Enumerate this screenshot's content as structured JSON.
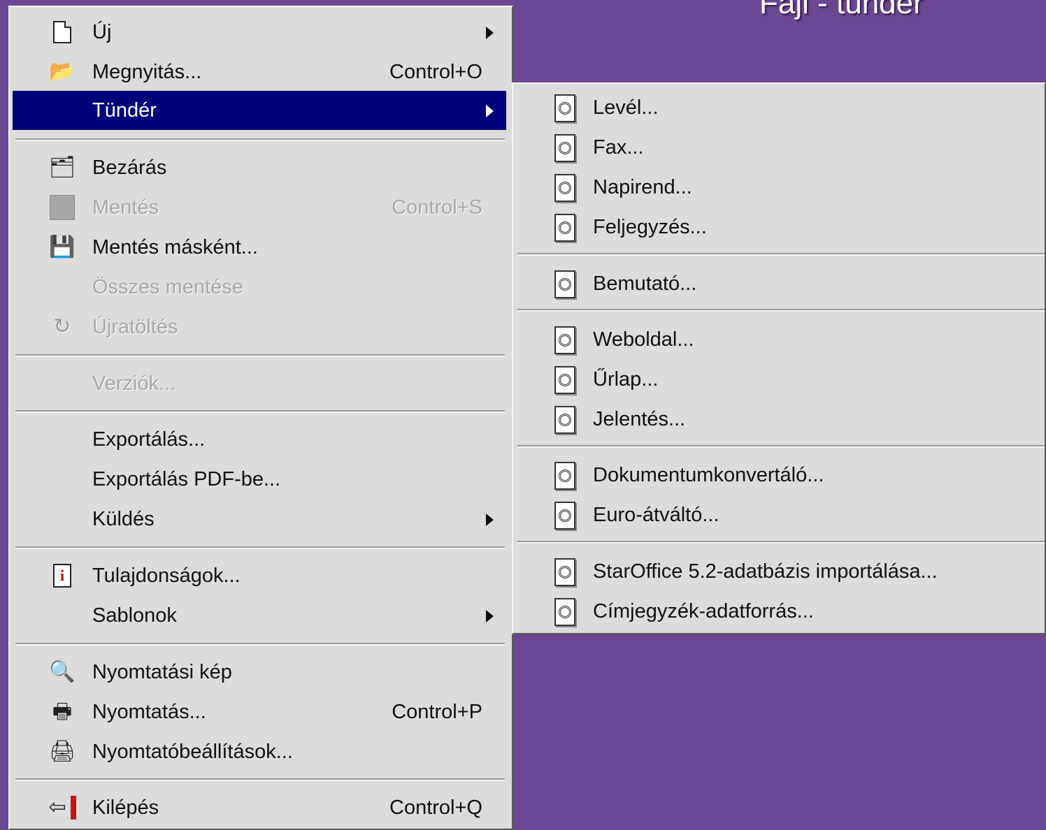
{
  "slide_title": "Fájl - tündér",
  "file_menu": {
    "items": [
      {
        "label": "Új",
        "icon": "new-document-icon",
        "submenu": true
      },
      {
        "label": "Megnyitás...",
        "icon": "open-folder-icon",
        "shortcut": "Control+O"
      },
      {
        "label": "Tündér",
        "submenu": true,
        "active": true
      },
      {
        "label": "Bezárás",
        "icon": "close-document-icon"
      },
      {
        "label": "Mentés",
        "icon": "save-icon",
        "shortcut": "Control+S",
        "disabled": true
      },
      {
        "label": "Mentés másként...",
        "icon": "save-as-icon"
      },
      {
        "label": "Összes mentése",
        "disabled": true
      },
      {
        "label": "Újratöltés",
        "icon": "reload-icon",
        "disabled": true
      },
      {
        "label": "Verziók...",
        "disabled": true
      },
      {
        "label": "Exportálás..."
      },
      {
        "label": "Exportálás PDF-be..."
      },
      {
        "label": "Küldés",
        "submenu": true
      },
      {
        "label": "Tulajdonságok...",
        "icon": "properties-icon"
      },
      {
        "label": "Sablonok",
        "submenu": true
      },
      {
        "label": "Nyomtatási kép",
        "icon": "print-preview-icon"
      },
      {
        "label": "Nyomtatás...",
        "icon": "printer-icon",
        "shortcut": "Control+P"
      },
      {
        "label": "Nyomtatóbeállítások...",
        "icon": "printer-settings-icon"
      },
      {
        "label": "Kilépés",
        "icon": "exit-icon",
        "shortcut": "Control+Q"
      }
    ]
  },
  "wizard_menu": {
    "items": [
      {
        "label": "Levél...",
        "icon": "wizard-icon"
      },
      {
        "label": "Fax...",
        "icon": "wizard-icon"
      },
      {
        "label": "Napirend...",
        "icon": "wizard-icon"
      },
      {
        "label": "Feljegyzés...",
        "icon": "wizard-icon"
      },
      {
        "label": "Bemutató...",
        "icon": "wizard-icon"
      },
      {
        "label": "Weboldal...",
        "icon": "wizard-icon"
      },
      {
        "label": "Űrlap...",
        "icon": "wizard-icon"
      },
      {
        "label": "Jelentés...",
        "icon": "wizard-icon"
      },
      {
        "label": "Dokumentumkonvertáló...",
        "icon": "wizard-icon"
      },
      {
        "label": "Euro-átváltó...",
        "icon": "wizard-icon"
      },
      {
        "label": "StarOffice 5.2-adatbázis importálása...",
        "icon": "wizard-icon"
      },
      {
        "label": "Címjegyzék-adatforrás...",
        "icon": "wizard-icon"
      }
    ]
  },
  "colors": {
    "background": "#6c4793",
    "menu_bg": "#dcdcdc",
    "highlight": "#00047a",
    "disabled_text": "#a9a9a9"
  }
}
